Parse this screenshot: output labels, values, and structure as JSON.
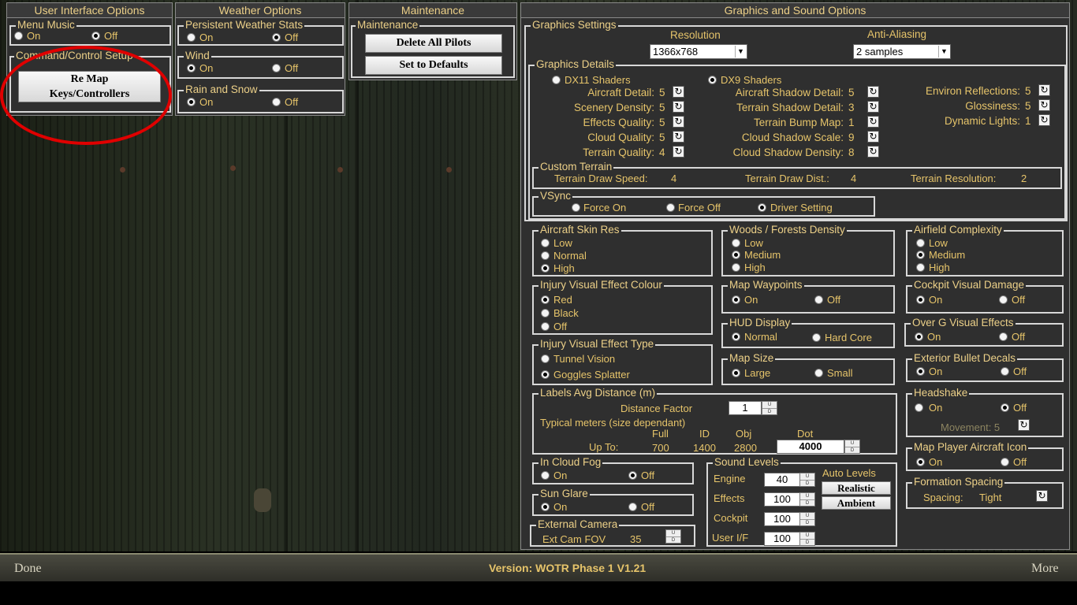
{
  "headers": {
    "ui": "User Interface Options",
    "weather": "Weather Options",
    "maint": "Maintenance",
    "gfx": "Graphics and Sound Options"
  },
  "menu_music": {
    "title": "Menu Music",
    "on": "On",
    "off": "Off"
  },
  "command": {
    "title": "Command/Control Setup",
    "remap_line1": "Re Map",
    "remap_line2": "Keys/Controllers"
  },
  "pws": {
    "title": "Persistent Weather Stats",
    "on": "On",
    "off": "Off"
  },
  "wind": {
    "title": "Wind",
    "on": "On",
    "off": "Off"
  },
  "rain": {
    "title": "Rain and Snow",
    "on": "On",
    "off": "Off"
  },
  "maintenance": {
    "title": "Maintenance",
    "delete": "Delete All Pilots",
    "defaults": "Set  to Defaults"
  },
  "gs": {
    "title": "Graphics Settings",
    "res_label": "Resolution",
    "res_value": "1366x768",
    "aa_label": "Anti-Aliasing",
    "aa_value": "2 samples"
  },
  "gd": {
    "title": "Graphics Details",
    "dx11": "DX11 Shaders",
    "dx9": "DX9 Shaders",
    "c1": [
      {
        "l": "Aircraft Detail:",
        "v": "5"
      },
      {
        "l": "Scenery Density:",
        "v": "5"
      },
      {
        "l": "Effects Quality:",
        "v": "5"
      },
      {
        "l": "Cloud Quality:",
        "v": "5"
      },
      {
        "l": "Terrain Quality:",
        "v": "4"
      }
    ],
    "c2": [
      {
        "l": "Aircraft Shadow Detail:",
        "v": "5"
      },
      {
        "l": "Terrain Shadow Detail:",
        "v": "3"
      },
      {
        "l": "Terrain Bump Map:",
        "v": "1"
      },
      {
        "l": "Cloud Shadow Scale:",
        "v": "9"
      },
      {
        "l": "Cloud Shadow Density:",
        "v": "8"
      }
    ],
    "c3": [
      {
        "l": "Environ Reflections:",
        "v": "5"
      },
      {
        "l": "Glossiness:",
        "v": "5"
      },
      {
        "l": "Dynamic Lights:",
        "v": "1"
      }
    ]
  },
  "ct": {
    "title": "Custom Terrain",
    "speed": "Terrain Draw Speed:",
    "speed_v": "4",
    "dist": "Terrain Draw Dist.:",
    "dist_v": "4",
    "res": "Terrain Resolution:",
    "res_v": "2"
  },
  "vsync": {
    "title": "VSync",
    "a": "Force On",
    "b": "Force Off",
    "c": "Driver Setting"
  },
  "skin": {
    "title": "Aircraft Skin Res",
    "a": "Low",
    "b": "Normal",
    "c": "High"
  },
  "woods": {
    "title": "Woods / Forests Density",
    "a": "Low",
    "b": "Medium",
    "c": "High"
  },
  "airfield": {
    "title": "Airfield Complexity",
    "a": "Low",
    "b": "Medium",
    "c": "High"
  },
  "injc": {
    "title": "Injury Visual Effect Colour",
    "a": "Red",
    "b": "Black",
    "c": "Off"
  },
  "mapw": {
    "title": "Map Waypoints",
    "on": "On",
    "off": "Off"
  },
  "cockd": {
    "title": "Cockpit Visual Damage",
    "on": "On",
    "off": "Off"
  },
  "hud": {
    "title": "HUD Display",
    "a": "Normal",
    "b": "Hard Core"
  },
  "overg": {
    "title": "Over G  Visual Effects",
    "on": "On",
    "off": "Off"
  },
  "injt": {
    "title": "Injury Visual Effect Type",
    "a": "Tunnel Vision",
    "b": "Goggles Splatter"
  },
  "maps": {
    "title": "Map Size",
    "a": "Large",
    "b": "Small"
  },
  "bullet": {
    "title": "Exterior Bullet Decals",
    "on": "On",
    "off": "Off"
  },
  "labels": {
    "title": "Labels Avg Distance (m)",
    "factor": "Distance Factor",
    "factor_v": "1",
    "typical": "Typical meters (size dependant)",
    "full": "Full",
    "id": "ID",
    "obj": "Obj",
    "dot": "Dot",
    "upto": "Up To:",
    "full_v": "700",
    "id_v": "1400",
    "obj_v": "2800",
    "dot_v": "4000"
  },
  "head": {
    "title": "Headshake",
    "on": "On",
    "off": "Off",
    "movement": "Movement: 5"
  },
  "mpai": {
    "title": "Map Player Aircraft Icon",
    "on": "On",
    "off": "Off"
  },
  "fog": {
    "title": "In Cloud Fog",
    "on": "On",
    "off": "Off"
  },
  "sound": {
    "title": "Sound Levels",
    "engine": "Engine",
    "engine_v": "40",
    "effects": "Effects",
    "effects_v": "100",
    "cockpit": "Cockpit",
    "cockpit_v": "100",
    "userif": "User I/F",
    "userif_v": "100",
    "auto": "Auto Levels",
    "realistic": "Realistic",
    "ambient": "Ambient"
  },
  "formation": {
    "title": "Formation Spacing",
    "label": "Spacing:",
    "value": "Tight"
  },
  "sun": {
    "title": "Sun Glare",
    "on": "On",
    "off": "Off"
  },
  "extcam": {
    "title": "External Camera",
    "label": "Ext Cam FOV",
    "value": "35"
  },
  "footer": {
    "done": "Done",
    "version": "Version: WOTR Phase 1 V1.21",
    "more": "More"
  },
  "ud": {
    "u": "U",
    "d": "D"
  },
  "colors": {
    "panel": "#2f2f2f",
    "label": "#e6c46a",
    "highlight": "#e00000"
  }
}
